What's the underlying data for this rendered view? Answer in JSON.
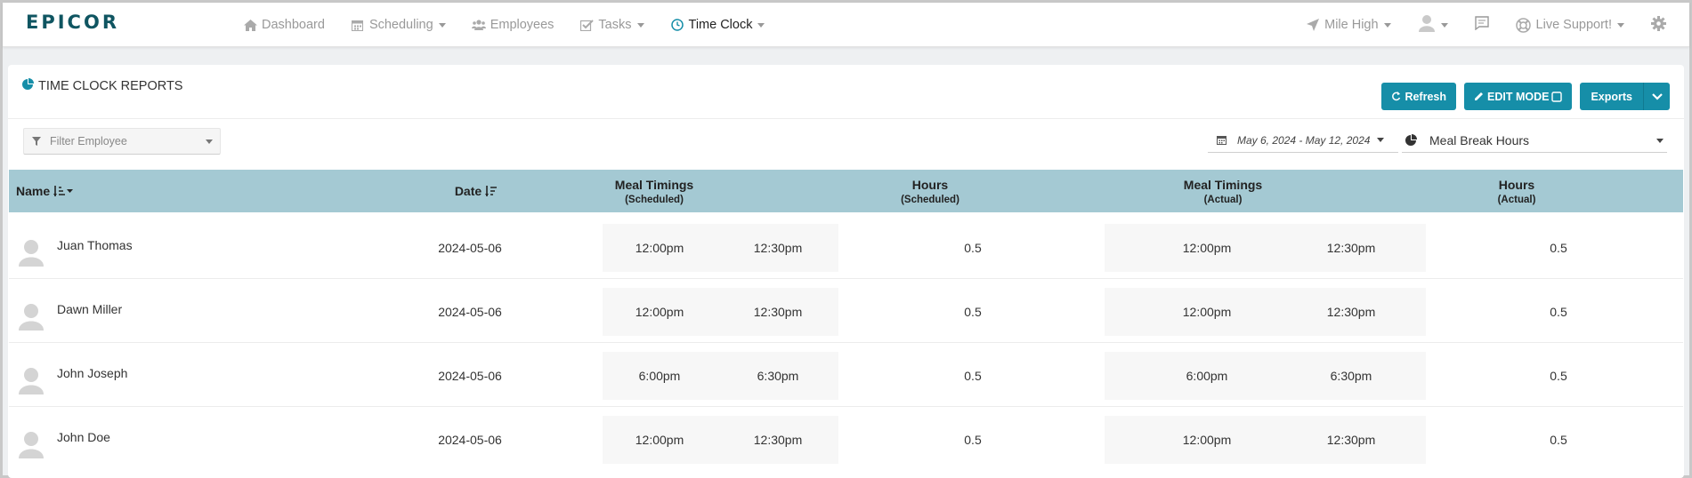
{
  "brand": {
    "logo": "EPICOR"
  },
  "nav": {
    "items": [
      {
        "label": "Dashboard",
        "icon": "home-icon",
        "caret": false,
        "active": false
      },
      {
        "label": "Scheduling",
        "icon": "calendar-icon",
        "caret": true,
        "active": false
      },
      {
        "label": "Employees",
        "icon": "users-icon",
        "caret": false,
        "active": false
      },
      {
        "label": "Tasks",
        "icon": "checkbox-icon",
        "caret": true,
        "active": false
      },
      {
        "label": "Time Clock",
        "icon": "clock-icon",
        "caret": true,
        "active": true
      }
    ],
    "location": "Mile High",
    "support": "Live Support!"
  },
  "panel": {
    "title": "TIME CLOCK REPORTS",
    "buttons": {
      "refresh": "Refresh",
      "edit_mode": "EDIT MODE",
      "exports": "Exports"
    },
    "filter_placeholder": "Filter Employee",
    "date_range": "May 6, 2024 - May 12, 2024",
    "report_type": "Meal Break Hours"
  },
  "table": {
    "headers": {
      "name": "Name",
      "date": "Date",
      "meal_sched": "Meal Timings",
      "meal_sched_sub": "(Scheduled)",
      "hours_sched": "Hours",
      "hours_sched_sub": "(Scheduled)",
      "meal_actual": "Meal Timings",
      "meal_actual_sub": "(Actual)",
      "hours_actual": "Hours",
      "hours_actual_sub": "(Actual)"
    },
    "rows": [
      {
        "name": "Juan Thomas",
        "date": "2024-05-06",
        "sched_start": "12:00pm",
        "sched_end": "12:30pm",
        "sched_hours": "0.5",
        "actual_start": "12:00pm",
        "actual_end": "12:30pm",
        "actual_hours": "0.5"
      },
      {
        "name": "Dawn Miller",
        "date": "2024-05-06",
        "sched_start": "12:00pm",
        "sched_end": "12:30pm",
        "sched_hours": "0.5",
        "actual_start": "12:00pm",
        "actual_end": "12:30pm",
        "actual_hours": "0.5"
      },
      {
        "name": "John Joseph",
        "date": "2024-05-06",
        "sched_start": "6:00pm",
        "sched_end": "6:30pm",
        "sched_hours": "0.5",
        "actual_start": "6:00pm",
        "actual_end": "6:30pm",
        "actual_hours": "0.5"
      },
      {
        "name": "John Doe",
        "date": "2024-05-06",
        "sched_start": "12:00pm",
        "sched_end": "12:30pm",
        "sched_hours": "0.5",
        "actual_start": "12:00pm",
        "actual_end": "12:30pm",
        "actual_hours": "0.5"
      }
    ]
  },
  "colors": {
    "brand": "#0f5561",
    "accent": "#168ea8",
    "table_header": "#a4c9d3"
  }
}
